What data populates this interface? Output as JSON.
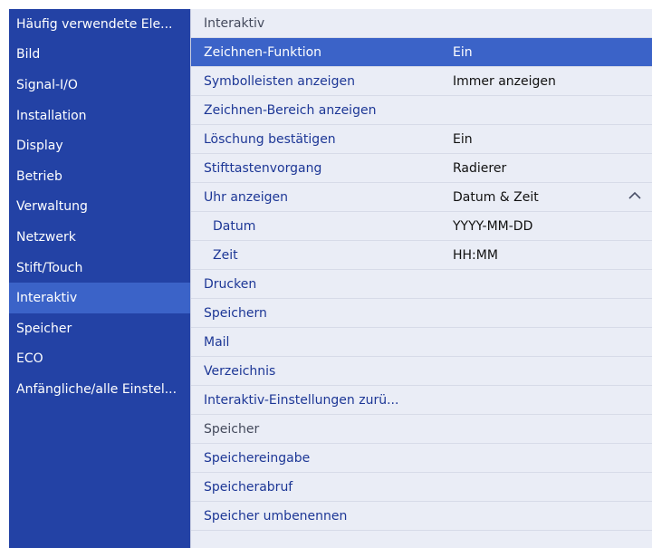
{
  "sidebar": {
    "items": [
      {
        "label": "Häufig verwendete Ele..."
      },
      {
        "label": "Bild"
      },
      {
        "label": "Signal-I/O"
      },
      {
        "label": "Installation"
      },
      {
        "label": "Display"
      },
      {
        "label": "Betrieb"
      },
      {
        "label": "Verwaltung"
      },
      {
        "label": "Netzwerk"
      },
      {
        "label": "Stift/Touch"
      },
      {
        "label": "Interaktiv"
      },
      {
        "label": "Speicher"
      },
      {
        "label": "ECO"
      },
      {
        "label": "Anfängliche/alle Einstel..."
      }
    ],
    "active_index": 9
  },
  "main": {
    "rows": [
      {
        "label": "Interaktiv",
        "value": ""
      },
      {
        "label": "Zeichnen-Funktion",
        "value": "Ein"
      },
      {
        "label": "Symbolleisten anzeigen",
        "value": "Immer anzeigen"
      },
      {
        "label": "Zeichnen-Bereich anzeigen",
        "value": ""
      },
      {
        "label": "Löschung bestätigen",
        "value": "Ein"
      },
      {
        "label": "Stifttastenvorgang",
        "value": "Radierer"
      },
      {
        "label": "Uhr anzeigen",
        "value": "Datum & Zeit",
        "icon": "chevron-up-icon"
      },
      {
        "label": "Datum",
        "value": "YYYY-MM-DD"
      },
      {
        "label": "Zeit",
        "value": "HH:MM"
      },
      {
        "label": "Drucken",
        "value": ""
      },
      {
        "label": "Speichern",
        "value": ""
      },
      {
        "label": "Mail",
        "value": ""
      },
      {
        "label": "Verzeichnis",
        "value": ""
      },
      {
        "label": "Interaktiv-Einstellungen zurü...",
        "value": ""
      },
      {
        "label": "Speicher",
        "value": ""
      },
      {
        "label": "Speichereingabe",
        "value": ""
      },
      {
        "label": "Speicherabruf",
        "value": ""
      },
      {
        "label": "Speicher umbenennen",
        "value": ""
      }
    ]
  },
  "colors": {
    "sidebar_bg": "#2342a5",
    "highlight": "#3b63c8",
    "panel_bg": "#eaedf6",
    "link_text": "#1d3796"
  }
}
